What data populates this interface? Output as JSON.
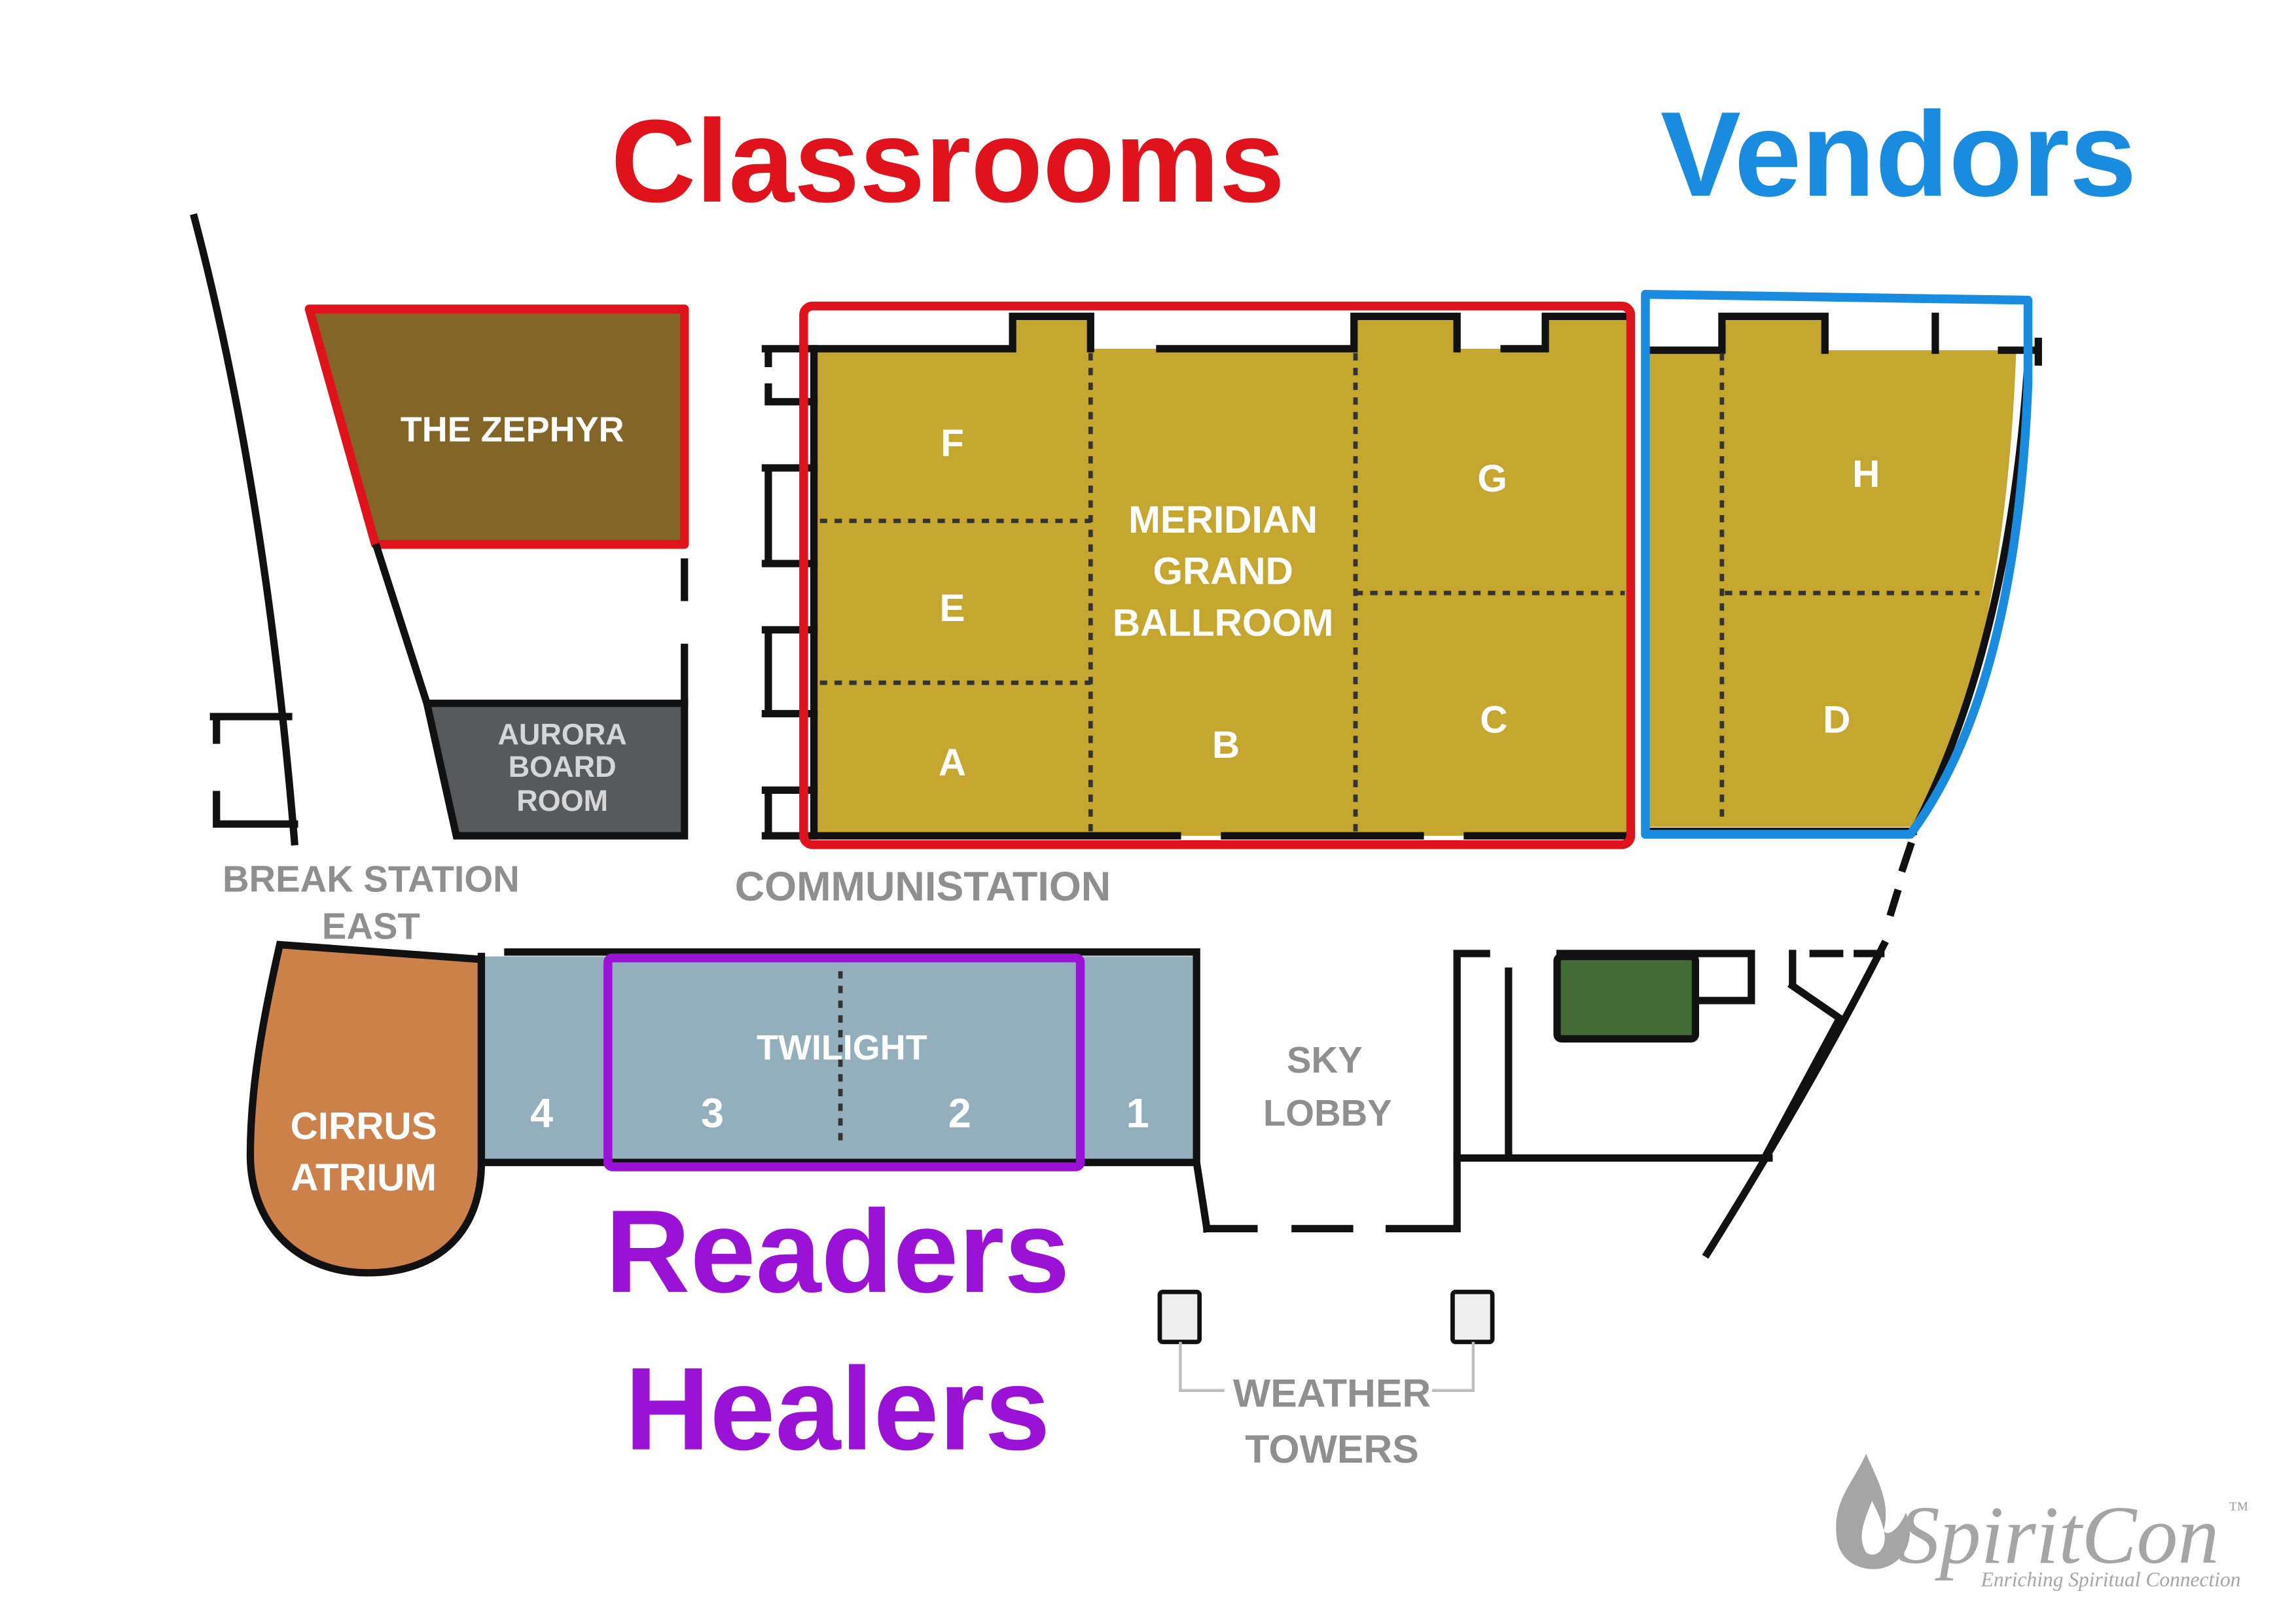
{
  "legend": {
    "classrooms": {
      "label": "Classrooms",
      "color": "#e0121b"
    },
    "vendors": {
      "label": "Vendors",
      "color": "#1a8ce0"
    },
    "readers_healers": {
      "line1": "Readers",
      "line2": "Healers",
      "color": "#9a12d6"
    }
  },
  "rooms": {
    "the_zephyr": {
      "label": "THE ZEPHYR"
    },
    "aurora_board_room": {
      "lines": [
        "AURORA",
        "BOARD",
        "ROOM"
      ]
    },
    "meridian_grand_ballroom": {
      "lines": [
        "MERIDIAN",
        "GRAND",
        "BALLROOM"
      ]
    },
    "ballroom_sections": {
      "F": "F",
      "E": "E",
      "A": "A",
      "B": "B",
      "G": "G",
      "C": "C"
    },
    "vendor_sections": {
      "H": "H",
      "D": "D"
    },
    "twilight": {
      "label": "TWILIGHT",
      "sections": [
        "4",
        "3",
        "2",
        "1"
      ]
    },
    "cirrus_atrium": {
      "lines": [
        "CIRRUS",
        "ATRIUM"
      ]
    }
  },
  "areas": {
    "break_station_east": {
      "lines": [
        "BREAK STATION",
        "EAST"
      ]
    },
    "communistation": {
      "label": "COMMUNISTATION"
    },
    "sky_lobby": {
      "lines": [
        "SKY",
        "LOBBY"
      ]
    },
    "weather_towers": {
      "lines": [
        "WEATHER",
        "TOWERS"
      ]
    }
  },
  "colors": {
    "the_zephyr": "#836528",
    "aurora_board_room": "#58595b",
    "gold_rooms": "#c5a62f",
    "twilight": "#93aebd",
    "cirrus_atrium": "#cd814a",
    "green_block": "#426b35",
    "weather_towers": "#eeeeee",
    "walls": "#111111",
    "area_text": "#8f8f8f",
    "room_text": "#ffffff",
    "logo": "#a5a5a5"
  },
  "logo": {
    "name": "SpiritCon",
    "trademark": "™",
    "tagline": "Enriching Spiritual Connection"
  }
}
